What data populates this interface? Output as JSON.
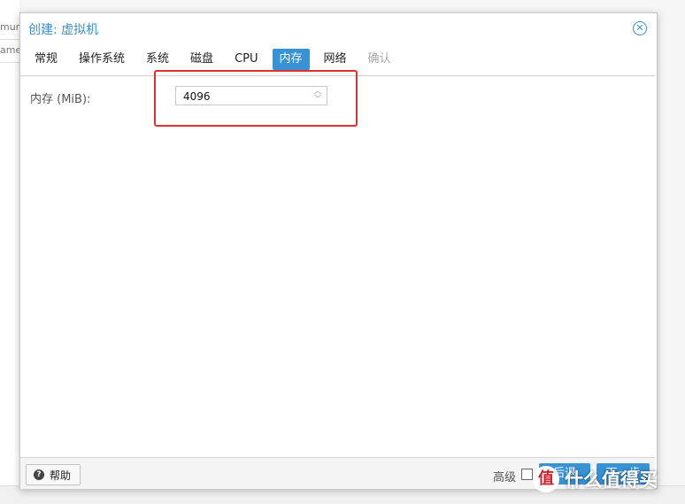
{
  "background": {
    "row1_text": "mur",
    "row2_text": "ame"
  },
  "dialog": {
    "title": "创建: 虚拟机",
    "close_icon": "close-circle-icon",
    "tabs": [
      {
        "label": "常规",
        "state": "normal"
      },
      {
        "label": "操作系统",
        "state": "normal"
      },
      {
        "label": "系统",
        "state": "normal"
      },
      {
        "label": "磁盘",
        "state": "normal"
      },
      {
        "label": "CPU",
        "state": "normal"
      },
      {
        "label": "内存",
        "state": "active"
      },
      {
        "label": "网络",
        "state": "normal"
      },
      {
        "label": "确认",
        "state": "disabled"
      }
    ],
    "memory": {
      "label": "内存 (MiB):",
      "value": "4096"
    },
    "footer": {
      "help_label": "帮助",
      "help_icon": "question-circle-icon",
      "advanced_label": "高级",
      "advanced_checked": false,
      "back_label": "后退",
      "next_label": "下一步"
    }
  },
  "watermark": {
    "text": "什么值得买",
    "icon_glyph": "值"
  },
  "colors": {
    "accent": "#3892d4",
    "title": "#3c8fc8",
    "highlight": "#e03030"
  }
}
